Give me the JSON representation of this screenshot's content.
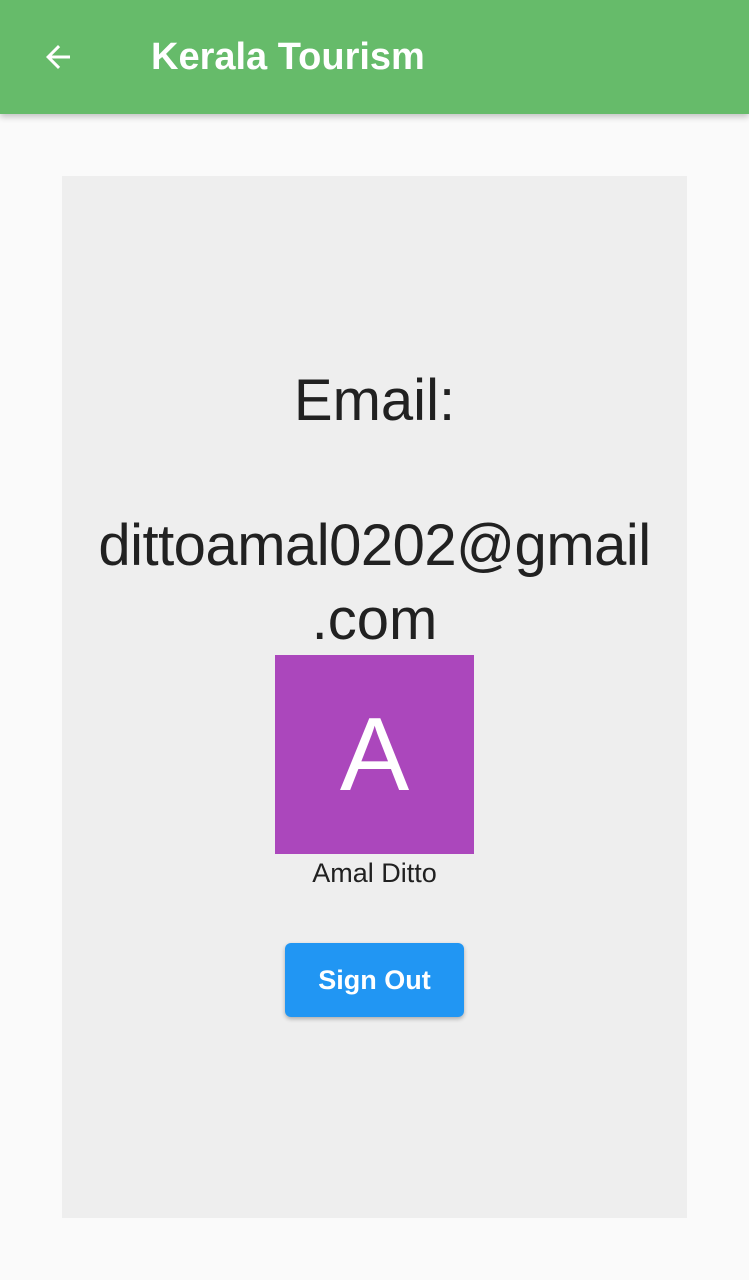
{
  "app_bar": {
    "title": "Kerala Tourism",
    "back_icon": "arrow-back-icon",
    "background_color": "#66bb6a"
  },
  "profile": {
    "email_label": "Email:",
    "email_line_1": "dittoamal0202@gmail",
    "email_line_2": ".com",
    "avatar_letter": "A",
    "avatar_color": "#ab47bc",
    "name": "Amal Ditto"
  },
  "actions": {
    "sign_out_label": "Sign Out",
    "sign_out_color": "#2196f3"
  }
}
